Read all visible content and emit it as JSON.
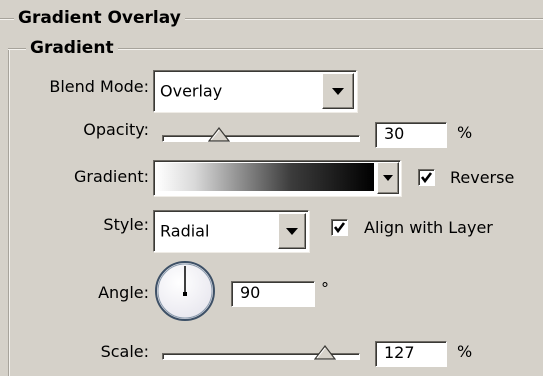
{
  "outer_group": {
    "title": "Gradient Overlay"
  },
  "inner_group": {
    "title": "Gradient"
  },
  "blend_mode": {
    "label": "Blend Mode:",
    "value": "Overlay"
  },
  "opacity": {
    "label": "Opacity:",
    "value": "30",
    "unit": "%",
    "level": 0.3
  },
  "gradient": {
    "label": "Gradient:",
    "reverse_label": "Reverse",
    "reverse_checked": true,
    "colors": [
      "#ffffff",
      "#000000"
    ]
  },
  "style": {
    "label": "Style:",
    "value": "Radial",
    "align_label": "Align with Layer",
    "align_checked": true
  },
  "angle": {
    "label": "Angle:",
    "value": "90",
    "unit": "°"
  },
  "scale": {
    "label": "Scale:",
    "value": "127",
    "unit": "%",
    "level": 0.847
  }
}
